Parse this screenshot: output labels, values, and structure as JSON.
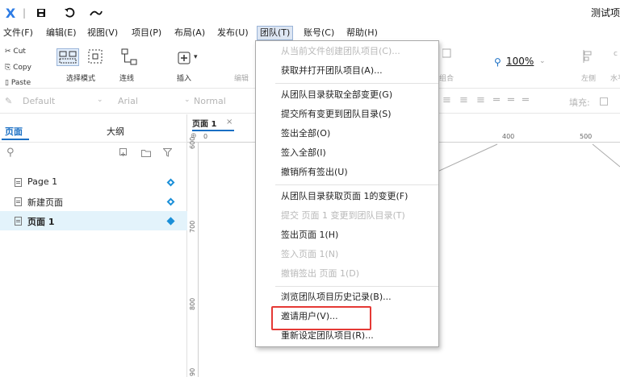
{
  "window": {
    "logo": "X",
    "title": "测试项",
    "tb_divider": "|"
  },
  "menubar": [
    {
      "label": "文件(F)"
    },
    {
      "label": "编辑(E)"
    },
    {
      "label": "视图(V)"
    },
    {
      "label": "项目(P)"
    },
    {
      "label": "布局(A)"
    },
    {
      "label": "发布(U)"
    },
    {
      "label": "团队(T)"
    },
    {
      "label": "账号(C)"
    },
    {
      "label": "帮助(H)"
    }
  ],
  "ribbon": {
    "cut": "Cut",
    "copy": "Copy",
    "paste": "Paste",
    "select_mode": "选择模式",
    "connect": "连线",
    "insert": "插入",
    "edit": "编辑",
    "combine": "组合",
    "zoom": "100%",
    "left_align": "左侧",
    "horizontal": "水平"
  },
  "formatbar": {
    "style": "Default",
    "font": "Arial",
    "weight": "Normal",
    "fill": "填充:"
  },
  "leftpanel": {
    "tab_pages": "页面",
    "tab_outline": "大纲",
    "pages": [
      {
        "label": "Page 1"
      },
      {
        "label": "新建页面"
      },
      {
        "label": "页面 1"
      }
    ]
  },
  "canvas": {
    "tab_label": "页面 1",
    "tab_close": "×",
    "ruler_h": [
      "0",
      "400",
      "500"
    ],
    "ruler_v": [
      "600",
      "700",
      "800",
      "90"
    ]
  },
  "team_menu": {
    "items": [
      {
        "label": "从当前文件创建团队项目(C)...",
        "enabled": false
      },
      {
        "label": "获取并打开团队项目(A)...",
        "enabled": true
      },
      {
        "label": "从团队目录获取全部变更(G)",
        "enabled": true
      },
      {
        "label": "提交所有变更到团队目录(S)",
        "enabled": true
      },
      {
        "label": "签出全部(O)",
        "enabled": true
      },
      {
        "label": "签入全部(I)",
        "enabled": true
      },
      {
        "label": "撤销所有签出(U)",
        "enabled": true
      },
      {
        "label": "从团队目录获取页面  1的变更(F)",
        "enabled": true
      },
      {
        "label": "提交 页面 1 变更到团队目录(T)",
        "enabled": false
      },
      {
        "label": "签出页面 1(H)",
        "enabled": true
      },
      {
        "label": "签入页面 1(N)",
        "enabled": false
      },
      {
        "label": "撤销签出 页面 1(D)",
        "enabled": false
      },
      {
        "label": "浏览团队项目历史记录(B)...",
        "enabled": true
      },
      {
        "label": "邀请用户(V)...",
        "enabled": true
      },
      {
        "label": "重新设定团队项目(R)...",
        "enabled": true
      }
    ]
  },
  "colors": {
    "accent": "#1a6fc4",
    "highlight": "#e53935",
    "selected_row": "#e3f3fb"
  }
}
